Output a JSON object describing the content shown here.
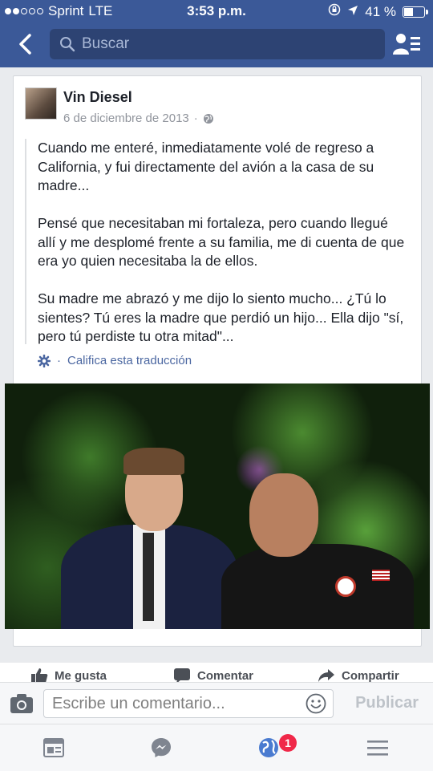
{
  "status_bar": {
    "carrier": "Sprint",
    "network": "LTE",
    "time": "3:53 p.m.",
    "battery_percent": "41 %",
    "battery_level": 0.41
  },
  "nav": {
    "back_icon": "chevron-left-icon",
    "search_placeholder": "Buscar",
    "friends_icon": "friend-requests-icon"
  },
  "post": {
    "author": "Vin Diesel",
    "date": "6 de diciembre de 2013",
    "privacy_icon": "globe-icon",
    "paragraphs": [
      "Cuando me enteré, inmediatamente volé de regreso a California, y fui directamente del avión a la casa de su madre...",
      "Pensé que necesitaban mi fortaleza, pero cuando llegué allí y me desplomé frente a su familia, me di cuenta de que era yo quien necesitaba la de ellos.",
      "Su madre me abrazó y me dijo lo siento mucho... ¿Tú lo sientes? Tú eres la madre que perdió un hijo... Ella dijo \"sí, pero tú perdiste tu otra mitad\"..."
    ],
    "translation_link": "Califica esta traducción"
  },
  "actions": {
    "like": "Me gusta",
    "comment": "Comentar",
    "share": "Compartir"
  },
  "comment_bar": {
    "placeholder": "Escribe un comentario...",
    "publish": "Publicar"
  },
  "tabbar": {
    "notifications_badge": "1"
  },
  "colors": {
    "brand": "#3b5998",
    "link": "#4b67a1",
    "badge": "#f02849"
  }
}
